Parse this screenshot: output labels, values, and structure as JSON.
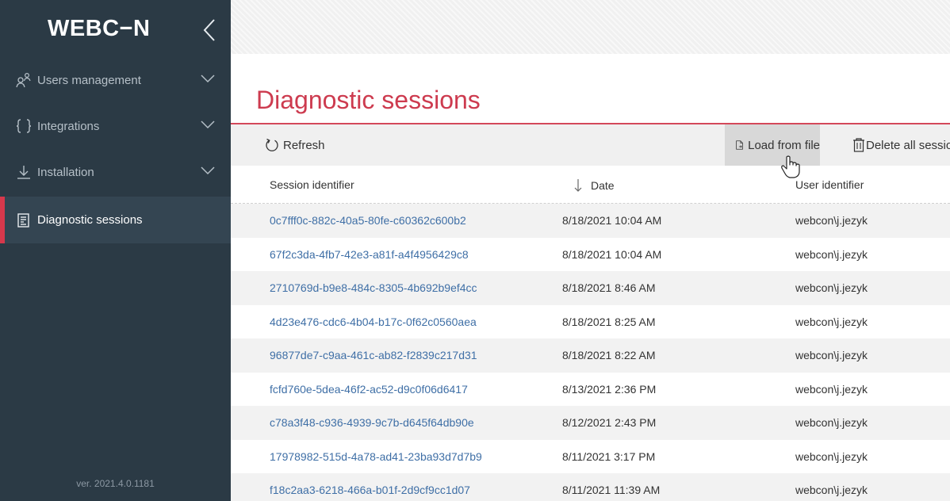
{
  "brand": {
    "logo_text": "WEBC−N"
  },
  "sidebar": {
    "items": [
      {
        "label": "Users management",
        "icon": "users-icon"
      },
      {
        "label": "Integrations",
        "icon": "braces-icon"
      },
      {
        "label": "Installation",
        "icon": "download-icon"
      },
      {
        "label": "Diagnostic sessions",
        "icon": "report-icon",
        "active": true
      }
    ],
    "version": "ver. 2021.4.0.1181"
  },
  "main": {
    "title": "Diagnostic sessions",
    "toolbar": {
      "refresh_label": "Refresh",
      "load_label": "Load from file",
      "delete_label": "Delete all sessions"
    },
    "table": {
      "columns": [
        "Session identifier",
        "Date",
        "User identifier"
      ],
      "sort_column": "Date",
      "rows": [
        {
          "id": "0c7fff0c-882c-40a5-80fe-c60362c600b2",
          "date": "8/18/2021 10:04 AM",
          "user": "webcon\\j.jezyk"
        },
        {
          "id": "67f2c3da-4fb7-42e3-a81f-a4f4956429c8",
          "date": "8/18/2021 10:04 AM",
          "user": "webcon\\j.jezyk"
        },
        {
          "id": "2710769d-b9e8-484c-8305-4b692b9ef4cc",
          "date": "8/18/2021 8:46 AM",
          "user": "webcon\\j.jezyk"
        },
        {
          "id": "4d23e476-cdc6-4b04-b17c-0f62c0560aea",
          "date": "8/18/2021 8:25 AM",
          "user": "webcon\\j.jezyk"
        },
        {
          "id": "96877de7-c9aa-461c-ab82-f2839c217d31",
          "date": "8/18/2021 8:22 AM",
          "user": "webcon\\j.jezyk"
        },
        {
          "id": "fcfd760e-5dea-46f2-ac52-d9c0f06d6417",
          "date": "8/13/2021 2:36 PM",
          "user": "webcon\\j.jezyk"
        },
        {
          "id": "c78a3f48-c936-4939-9c7b-d645f64db90e",
          "date": "8/12/2021 2:43 PM",
          "user": "webcon\\j.jezyk"
        },
        {
          "id": "17978982-515d-4a78-ad41-23ba93d7d7b9",
          "date": "8/11/2021 3:17 PM",
          "user": "webcon\\j.jezyk"
        },
        {
          "id": "f18c2aa3-6218-466a-b01f-2d9cf9cc1d07",
          "date": "8/11/2021 11:39 AM",
          "user": "webcon\\j.jezyk"
        }
      ]
    }
  },
  "colors": {
    "sidebar_bg": "#2b3a45",
    "accent": "#cd3b4f",
    "link": "#3f6fa6",
    "toolbar_bg": "#f0f0f0"
  },
  "cursor": {
    "icon": "hand-pointer-icon"
  }
}
